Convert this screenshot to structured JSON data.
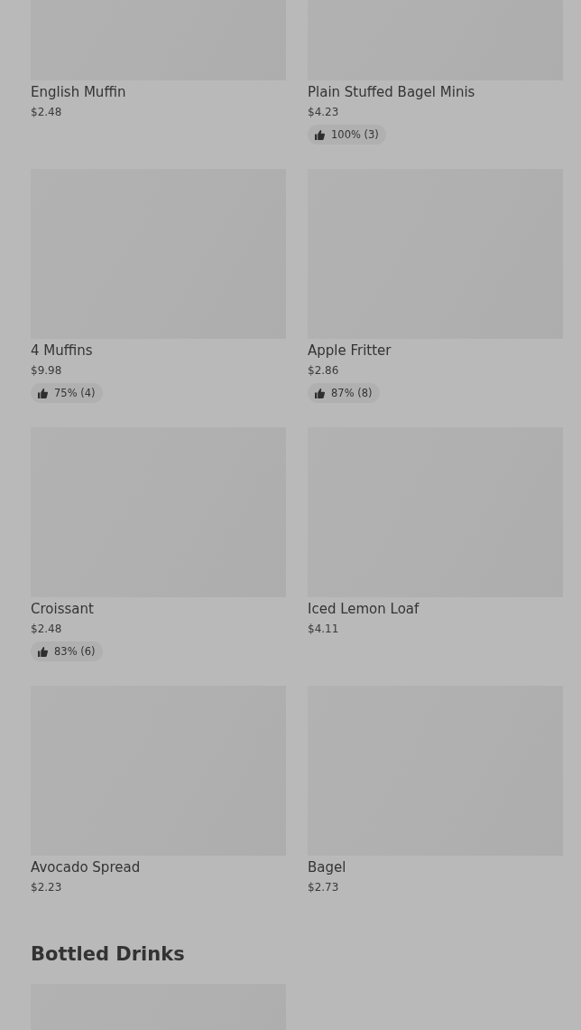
{
  "items": [
    {
      "name": "English Muffin",
      "price": "$2.48"
    },
    {
      "name": "Plain Stuffed Bagel Minis",
      "price": "$4.23",
      "rating": "100% (3)"
    },
    {
      "name": "4 Muffins",
      "price": "$9.98",
      "rating": "75% (4)"
    },
    {
      "name": "Apple Fritter",
      "price": "$2.86",
      "rating": "87% (8)"
    },
    {
      "name": "Croissant",
      "price": "$2.48",
      "rating": "83% (6)"
    },
    {
      "name": "Iced Lemon Loaf",
      "price": "$4.11"
    },
    {
      "name": "Avocado Spread",
      "price": "$2.23"
    },
    {
      "name": "Bagel",
      "price": "$2.73"
    }
  ],
  "section": {
    "title": "Bottled Drinks"
  }
}
